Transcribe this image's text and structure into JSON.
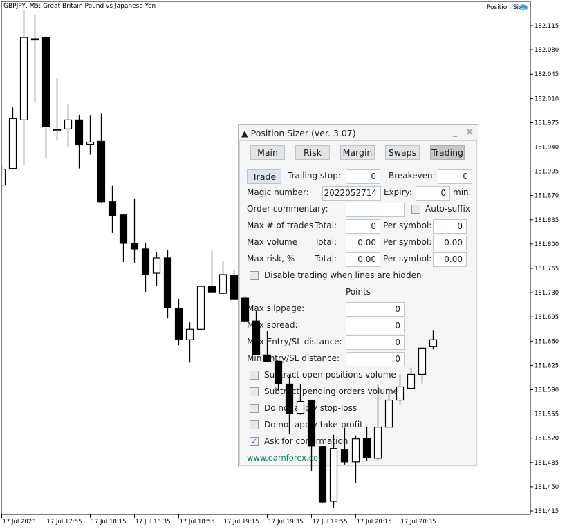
{
  "chart": {
    "symbol_line": "GBPJPY, M5:  Great Britain Pound vs Japanese Yen",
    "indicator_label": "Position Sizer",
    "indicator_icon": "graduation-cap-icon"
  },
  "chart_data": {
    "type": "candlestick",
    "ylim": [
      181.4,
      182.15
    ],
    "y_ticks": [
      "182.115",
      "182.080",
      "182.045",
      "182.010",
      "181.975",
      "181.940",
      "181.905",
      "181.870",
      "181.835",
      "181.800",
      "181.765",
      "181.730",
      "181.695",
      "181.660",
      "181.625",
      "181.590",
      "181.555",
      "181.520",
      "181.485",
      "181.450",
      "181.415"
    ],
    "x_ticks": [
      "17 Jul 2023",
      "17 Jul 17:55",
      "17 Jul 18:15",
      "17 Jul 18:35",
      "17 Jul 18:55",
      "17 Jul 19:15",
      "17 Jul 19:35",
      "17 Jul 19:55",
      "17 Jul 20:15",
      "17 Jul 20:35"
    ],
    "candles": [
      [
        181.885,
        181.913,
        181.885,
        181.908
      ],
      [
        181.909,
        181.997,
        181.909,
        181.981
      ],
      [
        181.979,
        182.137,
        181.914,
        182.098
      ],
      [
        182.096,
        182.131,
        182.004,
        182.096
      ],
      [
        182.098,
        182.1,
        181.923,
        181.97
      ],
      [
        181.965,
        182.039,
        181.949,
        181.965
      ],
      [
        181.966,
        182.001,
        181.94,
        181.979
      ],
      [
        181.979,
        181.986,
        181.909,
        181.943
      ],
      [
        181.944,
        181.985,
        181.929,
        181.947
      ],
      [
        181.948,
        181.988,
        181.86,
        181.861
      ],
      [
        181.861,
        181.884,
        181.816,
        181.841
      ],
      [
        181.842,
        181.843,
        181.774,
        181.801
      ],
      [
        181.801,
        181.865,
        181.772,
        181.793
      ],
      [
        181.793,
        181.801,
        181.731,
        181.756
      ],
      [
        181.758,
        181.789,
        181.74,
        181.78
      ],
      [
        181.78,
        181.792,
        181.693,
        181.708
      ],
      [
        181.707,
        181.721,
        181.654,
        181.663
      ],
      [
        181.662,
        181.687,
        181.629,
        181.677
      ],
      [
        181.677,
        181.74,
        181.677,
        181.739
      ],
      [
        181.739,
        181.79,
        181.731,
        181.731
      ],
      [
        181.729,
        181.775,
        181.728,
        181.756
      ],
      [
        181.755,
        181.762,
        181.719,
        181.72
      ],
      [
        181.722,
        181.725,
        181.687,
        181.689
      ],
      [
        181.689,
        181.703,
        181.64,
        181.64
      ],
      [
        181.64,
        181.675,
        181.63,
        181.631
      ],
      [
        181.631,
        181.631,
        181.588,
        181.599
      ],
      [
        181.598,
        181.611,
        181.526,
        181.556
      ],
      [
        181.556,
        181.598,
        181.554,
        181.573
      ],
      [
        181.575,
        181.575,
        181.473,
        181.509
      ],
      [
        181.508,
        181.508,
        181.426,
        181.428
      ],
      [
        181.429,
        181.525,
        181.42,
        181.505
      ],
      [
        181.503,
        181.535,
        181.482,
        181.486
      ],
      [
        181.486,
        181.524,
        181.455,
        181.519
      ],
      [
        181.52,
        181.536,
        181.487,
        181.492
      ],
      [
        181.491,
        181.597,
        181.487,
        181.536
      ],
      [
        181.536,
        181.584,
        181.536,
        181.575
      ],
      [
        181.575,
        181.612,
        181.569,
        181.594
      ],
      [
        181.592,
        181.622,
        181.592,
        181.612
      ],
      [
        181.612,
        181.65,
        181.599,
        181.65
      ],
      [
        181.652,
        181.676,
        181.648,
        181.662
      ]
    ],
    "candle_fields": [
      "open",
      "high",
      "low",
      "close"
    ],
    "grid": false
  },
  "panel": {
    "title": "Position Sizer (ver. 3.07)",
    "tabs": [
      {
        "label": "Main"
      },
      {
        "label": "Risk"
      },
      {
        "label": "Margin"
      },
      {
        "label": "Swaps"
      },
      {
        "label": "Trading",
        "selected": true
      }
    ],
    "trade_button": "Trade",
    "trailing_stop_label": "Trailing stop:",
    "trailing_stop": "0",
    "breakeven_label": "Breakeven:",
    "breakeven": "0",
    "magic_label": "Magic number:",
    "magic": "2022052714",
    "expiry_label": "Expiry:",
    "expiry": "0",
    "expiry_unit": "min.",
    "comment_label": "Order commentary:",
    "comment": "",
    "auto_suffix": "Auto-suffix",
    "auto_suffix_checked": false,
    "max_trades_label": "Max # of trades",
    "max_volume_label": "Max volume",
    "max_risk_label": "Max risk, %",
    "total_label": "Total:",
    "per_symbol_label": "Per symbol:",
    "max_trades_total": "0",
    "max_trades_per": "0",
    "max_volume_total": "0.00",
    "max_volume_per": "0.00",
    "max_risk_total": "0.00",
    "max_risk_per": "0.00",
    "disable_hidden": "Disable trading when lines are hidden",
    "points_header": "Points",
    "max_slippage_label": "Max slippage:",
    "max_slippage": "0",
    "max_spread_label": "Max spread:",
    "max_spread": "0",
    "max_entry_sl_label": "Max Entry/SL distance:",
    "max_entry_sl": "0",
    "min_entry_sl_label": "Min Entry/SL distance:",
    "min_entry_sl": "0",
    "checks": [
      {
        "label": "Subtract open positions volume",
        "checked": false
      },
      {
        "label": "Subtract pending orders volume",
        "checked": false
      },
      {
        "label": "Do not apply stop-loss",
        "checked": false
      },
      {
        "label": "Do not apply take-profit",
        "checked": false
      },
      {
        "label": "Ask for confirmation",
        "checked": true
      }
    ],
    "link": "www.earnforex.com",
    "link_color": "#00806a"
  }
}
